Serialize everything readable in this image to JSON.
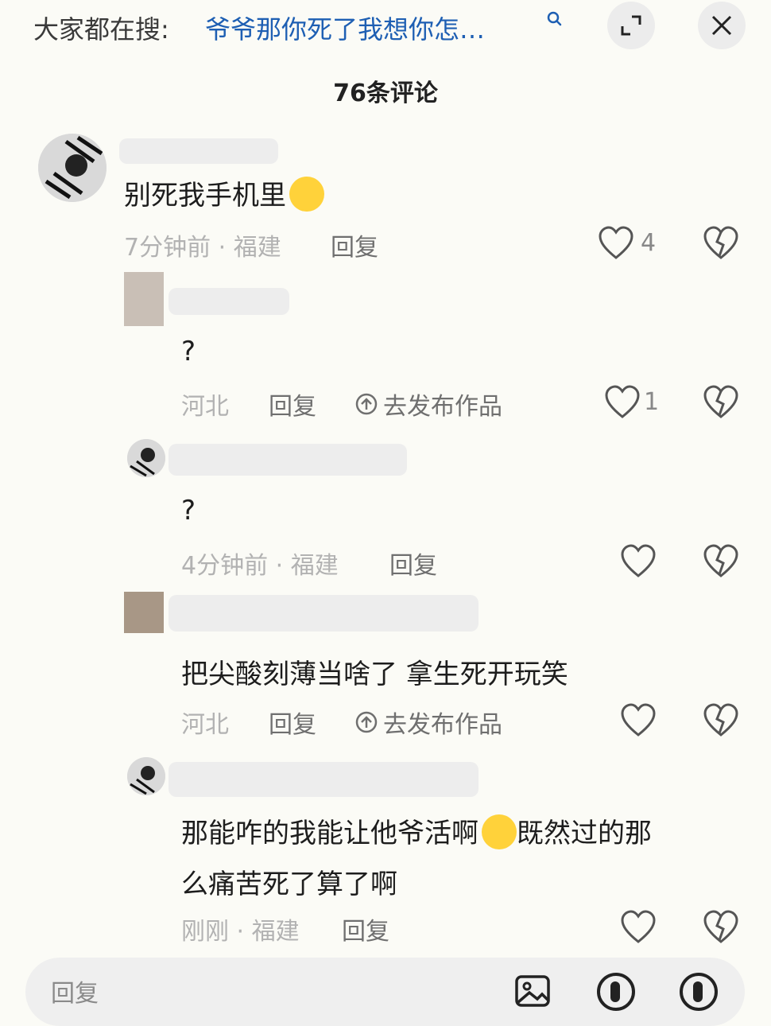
{
  "search": {
    "label": "大家都在搜:",
    "query": "爷爷那你死了我想你怎…"
  },
  "header": {
    "comment_count": "76条评论"
  },
  "comments": [
    {
      "text": "别死我手机里",
      "meta": "7分钟前 · 福建",
      "reply": "回复",
      "likes": "4"
    },
    {
      "text": "?",
      "meta": "河北",
      "reply": "回复",
      "publish": "去发布作品",
      "likes": "1"
    },
    {
      "text": "?",
      "meta": "4分钟前 · 福建",
      "reply": "回复",
      "likes": ""
    },
    {
      "text": "把尖酸刻薄当啥了 拿生死开玩笑",
      "meta": "河北",
      "reply": "回复",
      "publish": "去发布作品",
      "likes": ""
    },
    {
      "text_line1": "那能咋的我能让他爷活啊",
      "text_line1b": "既然过的那",
      "text_line2": "么痛苦死了算了啊",
      "meta": "刚刚 · 福建",
      "reply": "回复",
      "likes": ""
    }
  ],
  "input": {
    "placeholder": "回复"
  },
  "icons": [
    "search-icon",
    "expand-icon",
    "close-icon",
    "heart-icon",
    "broken-heart-icon",
    "upload-icon",
    "image-icon",
    "at-icon",
    "emoji-icon"
  ],
  "colors": {
    "background": "#fbfbf6",
    "link_blue": "#1e5fb3",
    "meta_gray": "#b2b2b2"
  }
}
